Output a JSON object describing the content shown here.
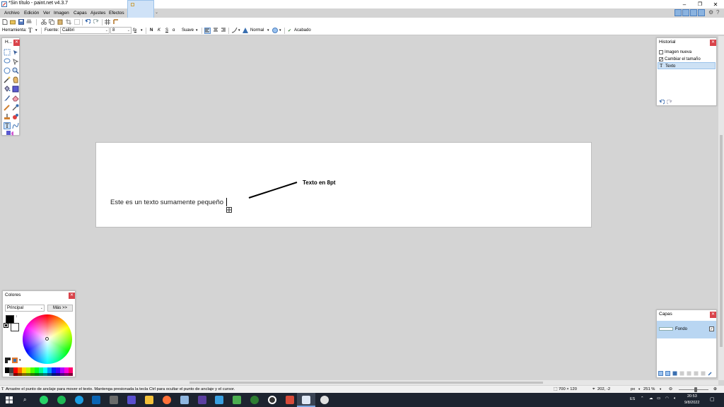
{
  "window": {
    "title": "*Sin título - paint.net v4.3.7",
    "controls": [
      "minimize-icon",
      "restore-icon",
      "close-icon"
    ]
  },
  "menu": [
    "Archivo",
    "Edición",
    "Ver",
    "Imagen",
    "Capas",
    "Ajustes",
    "Efectos"
  ],
  "toolbar": {
    "tool_label": "Herramienta:",
    "font_label": "Fuente:",
    "font_value": "Calibri",
    "font_size": "8",
    "bold": "N",
    "italic": "K",
    "underline": "S",
    "antialias": "Suave",
    "blend_mode": "Normal",
    "finish": "Acabado"
  },
  "canvas": {
    "text": "Este es un texto sumamente pequeño",
    "annotation": "Texto en 8pt"
  },
  "history": {
    "title": "Historial",
    "items": [
      {
        "label": "Imagen nueva",
        "active": false
      },
      {
        "label": "Cambiar el tamaño",
        "active": false
      },
      {
        "label": "Texto",
        "active": true
      }
    ]
  },
  "colors": {
    "title": "Colores",
    "mode": "Principal",
    "more_button": "Más >>",
    "primary": "#000000",
    "secondary": "#ffffff"
  },
  "layers": {
    "title": "Capas",
    "items": [
      {
        "label": "Fondo",
        "visible": true
      }
    ]
  },
  "status": {
    "hint": "Arrastre el punto de anclaje para mover el texto. Mantenga presionada la tecla Ctrl para ocultar el punto de anclaje y el cursor.",
    "size": "700 × 120",
    "position": "202, -2",
    "unit": "px",
    "zoom": "251 %"
  },
  "taskbar": {
    "lang": "ES",
    "time": "20:53",
    "date": "9/8/2022"
  }
}
